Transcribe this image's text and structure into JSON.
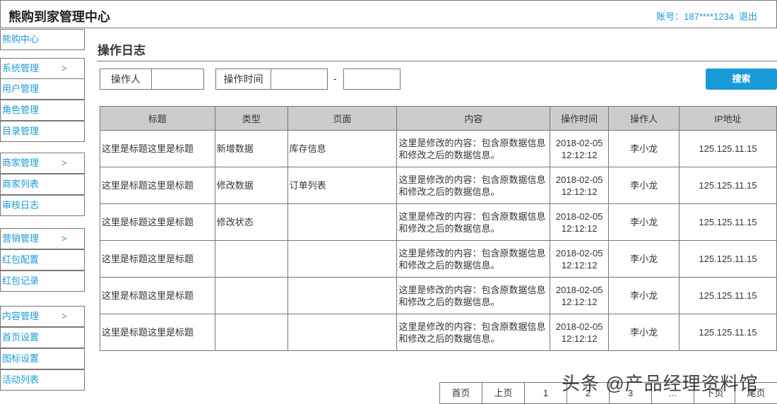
{
  "header": {
    "title": "熊购到家管理中心",
    "account": "账号：187****1234",
    "logout": "退出"
  },
  "sidebar": {
    "home": "熊购中心",
    "groups": [
      {
        "label": "系统管理",
        "arrow": ">",
        "items": [
          "用户管理",
          "角色管理",
          "目录管理"
        ]
      },
      {
        "label": "商家管理",
        "arrow": ">",
        "items": [
          "商家列表",
          "审核日志"
        ]
      },
      {
        "label": "营销管理",
        "arrow": ">",
        "items": [
          "红包配置",
          "红包记录"
        ]
      },
      {
        "label": "内容管理",
        "arrow": ">",
        "items": [
          "首页设置",
          "图标设置",
          "活动列表"
        ]
      }
    ]
  },
  "page": {
    "title": "操作日志"
  },
  "filters": {
    "operator_label": "操作人",
    "operator_value": "",
    "time_label": "操作时间",
    "time_start": "",
    "separator": "-",
    "time_end": "",
    "search": "搜索"
  },
  "table": {
    "headers": [
      "标题",
      "类型",
      "页面",
      "内容",
      "操作时间",
      "操作人",
      "IP地址"
    ],
    "rows": [
      [
        "这里是标题这里是标题",
        "新增数据",
        "库存信息",
        "这里是修改的内容：包含原数据信息和修改之后的数据信息。",
        "2018-02-05 12:12:12",
        "李小龙",
        "125.125.11.15"
      ],
      [
        "这里是标题这里是标题",
        "修改数据",
        "订单列表",
        "这里是修改的内容：包含原数据信息和修改之后的数据信息。",
        "2018-02-05 12:12:12",
        "李小龙",
        "125.125.11.15"
      ],
      [
        "这里是标题这里是标题",
        "修改状态",
        "",
        "这里是修改的内容：包含原数据信息和修改之后的数据信息。",
        "2018-02-05 12:12:12",
        "李小龙",
        "125.125.11.15"
      ],
      [
        "这里是标题这里是标题",
        "",
        "",
        "这里是修改的内容：包含原数据信息和修改之后的数据信息。",
        "2018-02-05 12:12:12",
        "李小龙",
        "125.125.11.15"
      ],
      [
        "这里是标题这里是标题",
        "",
        "",
        "这里是修改的内容：包含原数据信息和修改之后的数据信息。",
        "2018-02-05 12:12:12",
        "李小龙",
        "125.125.11.15"
      ],
      [
        "这里是标题这里是标题",
        "",
        "",
        "这里是修改的内容：包含原数据信息和修改之后的数据信息。",
        "2018-02-05 12:12:12",
        "李小龙",
        "125.125.11.15"
      ]
    ]
  },
  "pagination": [
    "首页",
    "上页",
    "1",
    "2",
    "3",
    "...",
    "下页",
    "尾页"
  ],
  "watermark": "头条 @产品经理资料馆",
  "colors": {
    "accent": "#1a9ad6",
    "header_bg": "#cccccc"
  }
}
